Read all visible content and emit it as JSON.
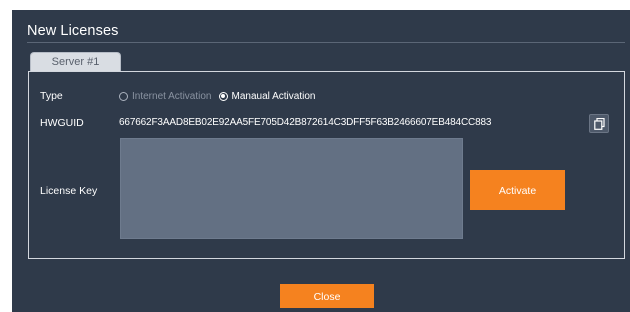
{
  "dialog": {
    "title": "New Licenses"
  },
  "tabs": [
    {
      "label": "Server #1",
      "selected": true
    }
  ],
  "form": {
    "type_label": "Type",
    "activation_options": [
      {
        "label": "Internet Activation",
        "selected": false,
        "enabled": false
      },
      {
        "label": "Manaual Activation",
        "selected": true,
        "enabled": true
      }
    ],
    "hwguid_label": "HWGUID",
    "hwguid_value": "667662F3AAD8EB02E92AA5FE705D42B872614C3DFF5F63B2466607EB484CC883",
    "copy_icon": "copy-icon",
    "license_key_label": "License Key",
    "license_key_value": "",
    "activate_label": "Activate"
  },
  "footer": {
    "close_label": "Close"
  },
  "colors": {
    "background": "#2f3a4a",
    "accent": "#f5821f",
    "textarea": "#637083"
  }
}
